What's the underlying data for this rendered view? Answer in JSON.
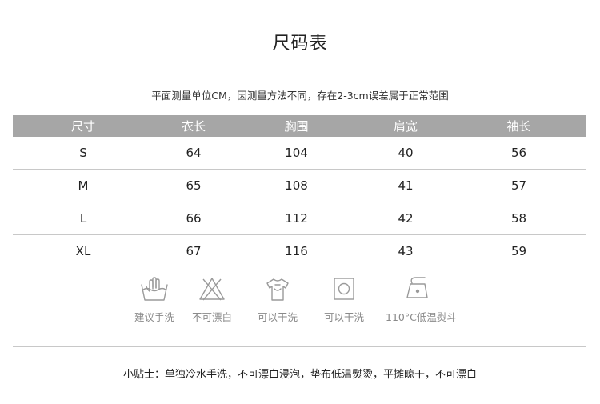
{
  "title": "尺码表",
  "subtitle": "平面测量单位CM，因测量方法不同，存在2-3cm误差属于正常范围",
  "table": {
    "headers": [
      "尺寸",
      "衣长",
      "胸围",
      "肩宽",
      "袖长"
    ],
    "rows": [
      [
        "S",
        "64",
        "104",
        "40",
        "56"
      ],
      [
        "M",
        "65",
        "108",
        "41",
        "57"
      ],
      [
        "L",
        "66",
        "112",
        "42",
        "58"
      ],
      [
        "XL",
        "67",
        "116",
        "43",
        "59"
      ]
    ]
  },
  "care": [
    {
      "icon": "hand-wash-icon",
      "label": "建议手洗"
    },
    {
      "icon": "no-bleach-icon",
      "label": "不可漂白"
    },
    {
      "icon": "hang-dry-icon",
      "label": "可以干洗"
    },
    {
      "icon": "tumble-dry-icon",
      "label": "可以干洗"
    },
    {
      "icon": "iron-low-icon",
      "label": "110°C低温熨斗"
    }
  ],
  "tips": "小贴士：单独冷水手洗，不可漂白浸泡，垫布低温熨烫，平摊晾干，不可漂白",
  "colors": {
    "header_bg": "#a6a6a6",
    "icon_gray": "#9a9a9a",
    "label_gray": "#8a8a8a"
  }
}
